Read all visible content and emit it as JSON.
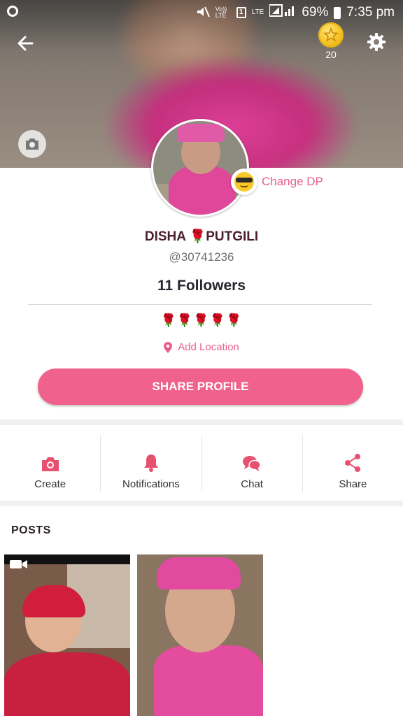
{
  "status_bar": {
    "carrier_badge": "1",
    "volte": "Vo)) LTE",
    "lte": "LTE",
    "battery": "69%",
    "time": "7:35 pm"
  },
  "top_bar": {
    "coin_count": "20"
  },
  "profile": {
    "change_dp_label": "Change DP",
    "name": "DISHA 🌹PUTGILI",
    "handle": "@30741236",
    "followers": "11 Followers",
    "bio": "🌹🌹🌹🌹🌹",
    "location_label": "Add Location",
    "share_button": "SHARE PROFILE"
  },
  "actions": [
    {
      "label": "Create",
      "icon": "camera-icon"
    },
    {
      "label": "Notifications",
      "icon": "bell-icon"
    },
    {
      "label": "Chat",
      "icon": "chat-icon"
    },
    {
      "label": "Share",
      "icon": "share-icon"
    }
  ],
  "posts": {
    "title": "POSTS",
    "items": [
      {
        "type": "video"
      },
      {
        "type": "image"
      }
    ]
  },
  "colors": {
    "accent": "#f0628d",
    "accent_text": "#e85e8a",
    "name": "#4a1e2c"
  }
}
